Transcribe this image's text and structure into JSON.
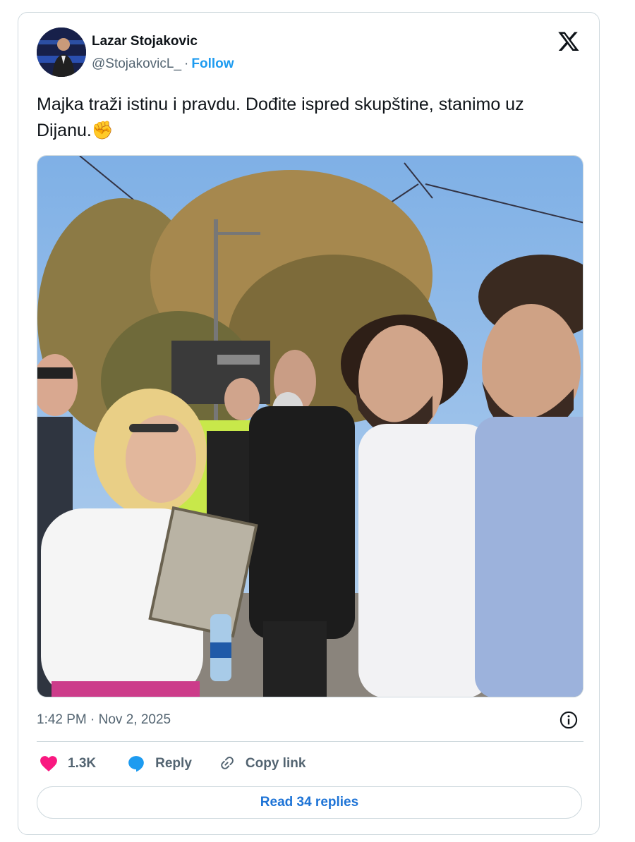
{
  "author": {
    "name": "Lazar Stojakovic",
    "handle": "@StojakovicL_",
    "separator": "·",
    "follow_label": "Follow"
  },
  "tweet": {
    "text": "Majka traži istinu i pravdu. Dođite ispred skupštine, stanimo uz Dijanu.",
    "emoji": "✊",
    "timestamp": "1:42 PM · Nov 2, 2025"
  },
  "actions": {
    "likes": "1.3K",
    "reply_label": "Reply",
    "copy_label": "Copy link"
  },
  "replies_button": "Read 34 replies",
  "colors": {
    "accent": "#1d9bf0",
    "like": "#f91880",
    "text_secondary": "#536471",
    "border": "#cfd9de"
  },
  "icons": [
    "x-logo-icon",
    "heart-icon",
    "reply-bubble-icon",
    "link-icon",
    "info-icon"
  ]
}
